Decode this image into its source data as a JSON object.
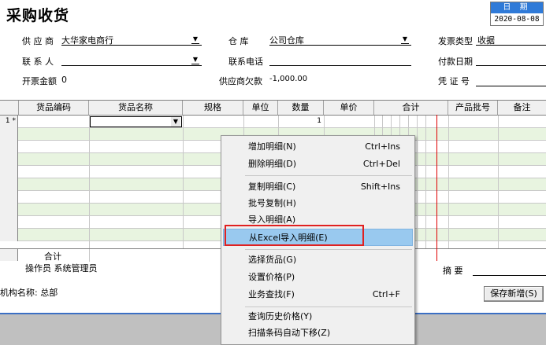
{
  "window": {
    "title": "采购收货"
  },
  "date": {
    "label": "日 期",
    "value": "2020-08-08"
  },
  "header": {
    "supplier_label": "供 应 商",
    "supplier_value": "大华家电商行",
    "warehouse_label": "仓   库",
    "warehouse_value": "公司仓库",
    "invoice_type_label": "发票类型",
    "invoice_type_value": "收据",
    "contact_label": "联 系 人",
    "contact_phone_label": "联系电话",
    "payment_date_label": "付款日期",
    "invoice_amount_label": "开票金额",
    "invoice_amount_value": "0",
    "supplier_debt_label": "供应商欠款",
    "supplier_debt_value": "-1,000.00",
    "voucher_label": "凭 证 号"
  },
  "grid": {
    "columns": [
      "货品编码",
      "货品名称",
      "规格",
      "单位",
      "数量",
      "单价",
      "合计",
      "产品批号",
      "备注"
    ],
    "row1_label": "1 *",
    "row1_qty": "1",
    "total_label": "合计"
  },
  "footer": {
    "operator": "操作员 系统管理员",
    "summary_label": "摘  要",
    "org_name": "机构名称: 总部",
    "save_new_button": "保存新增(S)"
  },
  "context_menu": {
    "items": [
      {
        "label": "增加明细(N)",
        "shortcut": "Ctrl+Ins"
      },
      {
        "label": "删除明细(D)",
        "shortcut": "Ctrl+Del"
      },
      {
        "label": "复制明细(C)",
        "shortcut": "Shift+Ins"
      },
      {
        "label": "批号复制(H)",
        "shortcut": ""
      },
      {
        "label": "导入明细(A)",
        "shortcut": ""
      },
      {
        "label": "从Excel导入明细(E)",
        "shortcut": ""
      },
      {
        "label": "选择货品(G)",
        "shortcut": ""
      },
      {
        "label": "设置价格(P)",
        "shortcut": ""
      },
      {
        "label": "业务查找(F)",
        "shortcut": "Ctrl+F"
      },
      {
        "label": "查询历史价格(Y)",
        "shortcut": ""
      },
      {
        "label": "扫描条码自动下移(Z)",
        "shortcut": ""
      }
    ],
    "highlighted_index": 5
  },
  "colors": {
    "accent": "#2f7ad8",
    "grid_alt_row": "#e8f4e0",
    "highlight": "#99c9ef",
    "red_outline": "#e02020"
  }
}
